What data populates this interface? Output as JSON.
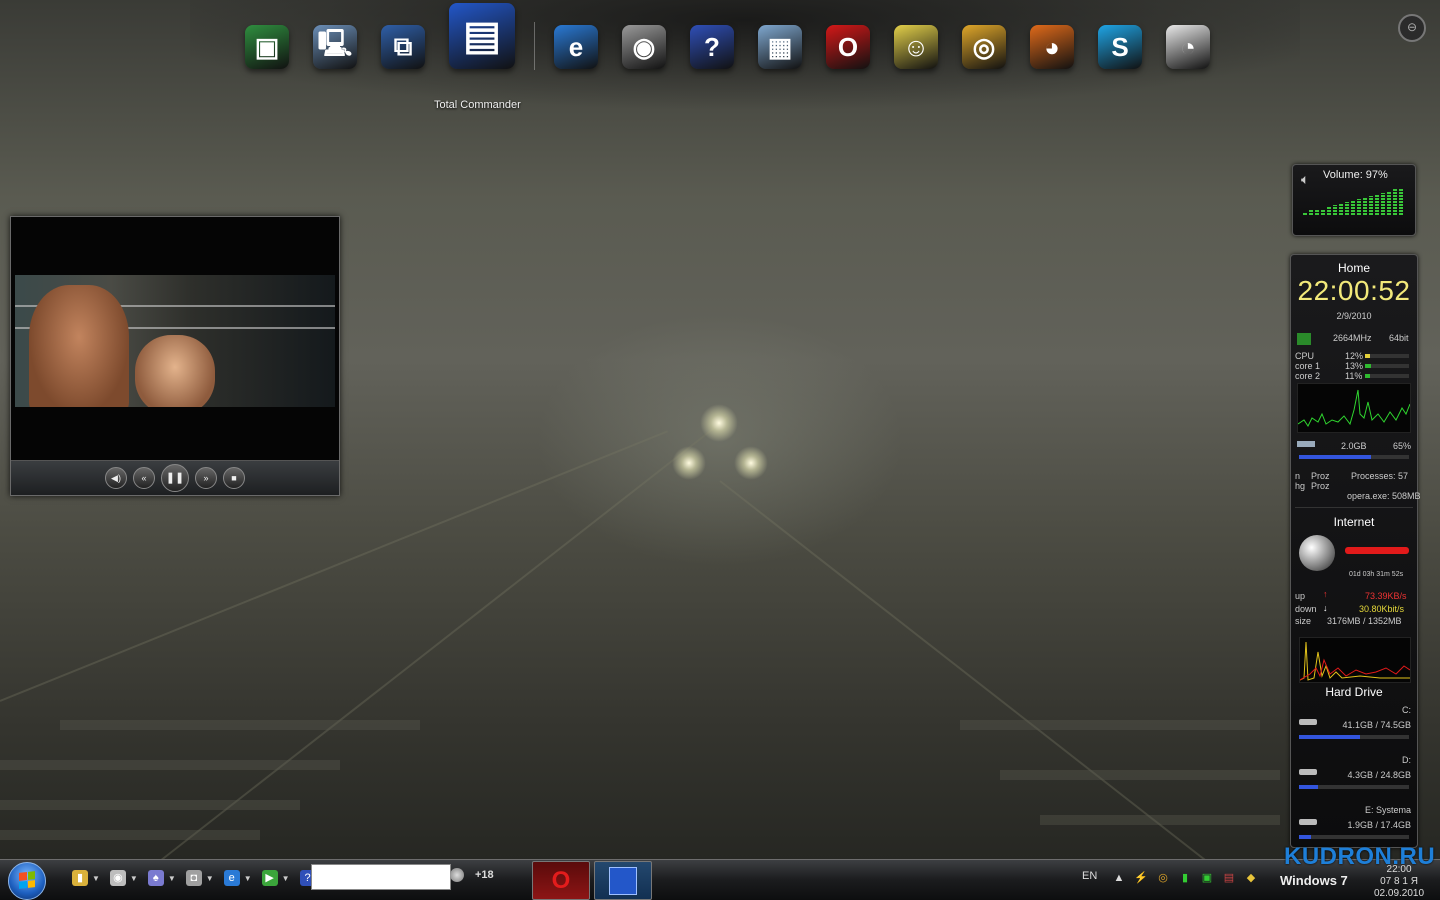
{
  "dock": {
    "items": [
      {
        "name": "green-cube-icon",
        "glyph": "▣",
        "color": "#2f8f3f"
      },
      {
        "name": "computer-icon",
        "glyph": "🖳",
        "color": "#6b8fb8"
      },
      {
        "name": "network-icon",
        "glyph": "⧉",
        "color": "#2f5fa8"
      },
      {
        "name": "floppy-disk-icon",
        "glyph": "▤",
        "color": "#2357c9"
      },
      {
        "name": "internet-explorer-icon",
        "glyph": "e",
        "color": "#2a7ad6"
      },
      {
        "name": "speaker-icon",
        "glyph": "◉",
        "color": "#9a9a9a"
      },
      {
        "name": "help-icon",
        "glyph": "?",
        "color": "#2f4fb8"
      },
      {
        "name": "photo-gallery-icon",
        "glyph": "▦",
        "color": "#7fa8d0"
      },
      {
        "name": "opera-icon",
        "glyph": "O",
        "color": "#d41818"
      },
      {
        "name": "sticky-note-icon",
        "glyph": "☺",
        "color": "#e3d04a"
      },
      {
        "name": "webcam-icon",
        "glyph": "◎",
        "color": "#e0a72a"
      },
      {
        "name": "firefox-icon",
        "glyph": "◕",
        "color": "#e06a1a"
      },
      {
        "name": "skype-icon",
        "glyph": "S",
        "color": "#1fa5e6"
      },
      {
        "name": "pie-chart-icon",
        "glyph": "◔",
        "color": "#e9e9e9"
      }
    ],
    "hover_label": "Total Commander"
  },
  "volume_gadget": {
    "label": "Volume: 97%",
    "level": 0.97,
    "bars": [
      2,
      3,
      4,
      4,
      5,
      6,
      7,
      8,
      9,
      10,
      11,
      12,
      13,
      14,
      15,
      16,
      17
    ]
  },
  "system_gadget": {
    "home_title": "Home",
    "time": "22:00:52",
    "date": "2/9/2010",
    "cpu_freq": "2664MHz",
    "cpu_arch": "64bit",
    "cpu_rows": [
      {
        "label": "CPU",
        "value": "12%",
        "fraction": 0.12
      },
      {
        "label": "core 1",
        "value": "13%",
        "fraction": 0.13
      },
      {
        "label": "core 2",
        "value": "11%",
        "fraction": 0.11
      }
    ],
    "ram_used": "2.0GB",
    "ram_pct": "65%",
    "ram_fraction": 0.65,
    "proc_col1": "n",
    "proc_col1b": "hg",
    "proc_label1": "Proz",
    "proc_label2": "Proz",
    "processes": "Processes: 57",
    "top_proc": "opera.exe: 508MB",
    "internet_title": "Internet",
    "uptime": "01d 03h 31m 52s",
    "up_label": "up",
    "up_value": "73.39KB/s",
    "down_label": "down",
    "down_value": "30.80Kbit/s",
    "size_label": "size",
    "size_value": "3176MB / 1352MB",
    "hdd_title": "Hard Drive",
    "drives": [
      {
        "letter": "C:",
        "usage": "41.1GB / 74.5GB",
        "fraction": 0.55
      },
      {
        "letter": "D:",
        "usage": "4.3GB / 24.8GB",
        "fraction": 0.17
      },
      {
        "letter": "E: Systema",
        "usage": "1.9GB / 17.4GB",
        "fraction": 0.11
      }
    ]
  },
  "taskbar": {
    "quick_launch": [
      {
        "name": "folder-icon",
        "glyph": "▮",
        "color": "#d9b13b"
      },
      {
        "name": "disc-icon",
        "glyph": "◉",
        "color": "#bdbdbd"
      },
      {
        "name": "cards-icon",
        "glyph": "♠",
        "color": "#7a7ad0"
      },
      {
        "name": "speaker-small-icon",
        "glyph": "◘",
        "color": "#a0a0a0"
      },
      {
        "name": "ie-small-icon",
        "glyph": "e",
        "color": "#2a7ad6"
      },
      {
        "name": "media-play-icon",
        "glyph": "▶",
        "color": "#3ba53b"
      },
      {
        "name": "help-small-icon",
        "glyph": "?",
        "color": "#2f4fb8"
      }
    ],
    "search_value": "",
    "counter": "+18",
    "language": "EN",
    "win_label": "Windows 7",
    "clock_time": "22:00",
    "clock_date": "02.09.2010",
    "tray_extra": "07 8 1 Я"
  },
  "watermark": "KUDRON.RU"
}
